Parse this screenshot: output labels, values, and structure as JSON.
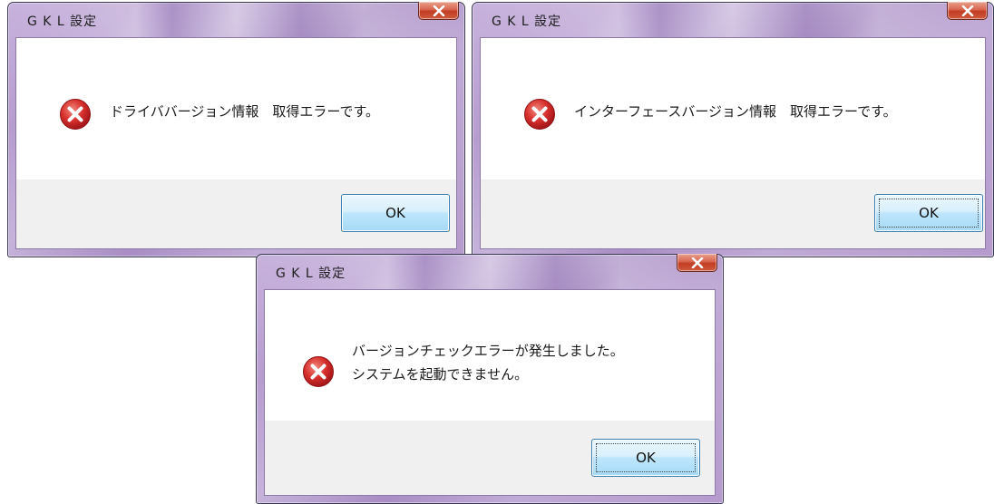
{
  "dialogs": [
    {
      "title": "G K L  設定",
      "message_lines": [
        "ドライババージョン情報　取得エラーです。"
      ],
      "ok_label": "OK",
      "icon": "error-icon"
    },
    {
      "title": "G K L  設定",
      "message_lines": [
        "インターフェースバージョン情報　取得エラーです。"
      ],
      "ok_label": "OK",
      "icon": "error-icon"
    },
    {
      "title": "G K L  設定",
      "message_lines": [
        "バージョンチェックエラーが発生しました。",
        "システムを起動できません。"
      ],
      "ok_label": "OK",
      "icon": "error-icon"
    }
  ],
  "colors": {
    "frame": "#b89ed0",
    "close_button": "#c9472c",
    "error_icon": "#c8262a",
    "button_area": "#f0f0f0",
    "ok_border": "#3c7fb1"
  }
}
